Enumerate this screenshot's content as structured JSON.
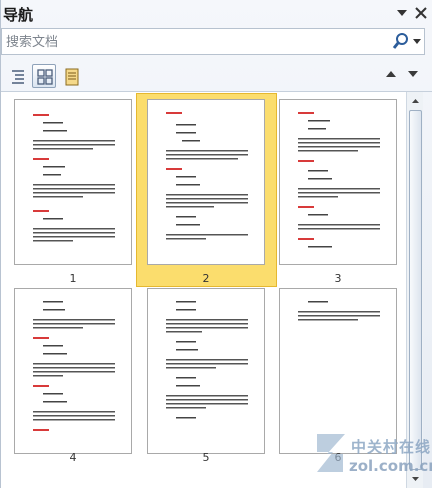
{
  "header": {
    "title": "导航"
  },
  "search": {
    "placeholder": "搜索文档"
  },
  "tabs": [
    {
      "icon": "heading-list-icon"
    },
    {
      "icon": "page-thumbnails-icon"
    },
    {
      "icon": "search-results-icon"
    }
  ],
  "thumbnails": [
    {
      "label": "1"
    },
    {
      "label": "2"
    },
    {
      "label": "3"
    },
    {
      "label": "4"
    },
    {
      "label": "5"
    },
    {
      "label": "6"
    }
  ],
  "selected_page": "2",
  "watermark": {
    "text": "中关村在线",
    "domain": "zol.com.cn"
  },
  "colors": {
    "selected": "#fbdd6d",
    "heading_red": "#d83a3a",
    "text": "#444444"
  }
}
